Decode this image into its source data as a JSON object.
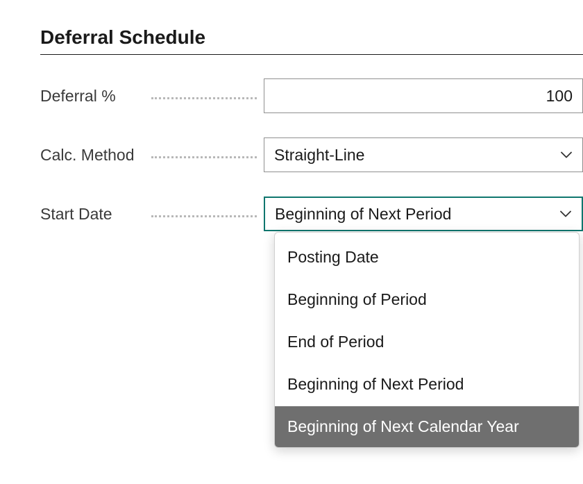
{
  "section": {
    "title": "Deferral Schedule"
  },
  "fields": {
    "deferral_percent": {
      "label": "Deferral %",
      "value": "100"
    },
    "calc_method": {
      "label": "Calc. Method",
      "value": "Straight-Line"
    },
    "start_date": {
      "label": "Start Date",
      "value": "Beginning of Next Period",
      "options": [
        "Posting Date",
        "Beginning of Period",
        "End of Period",
        "Beginning of Next Period",
        "Beginning of Next Calendar Year"
      ],
      "highlighted_index": 4
    }
  }
}
